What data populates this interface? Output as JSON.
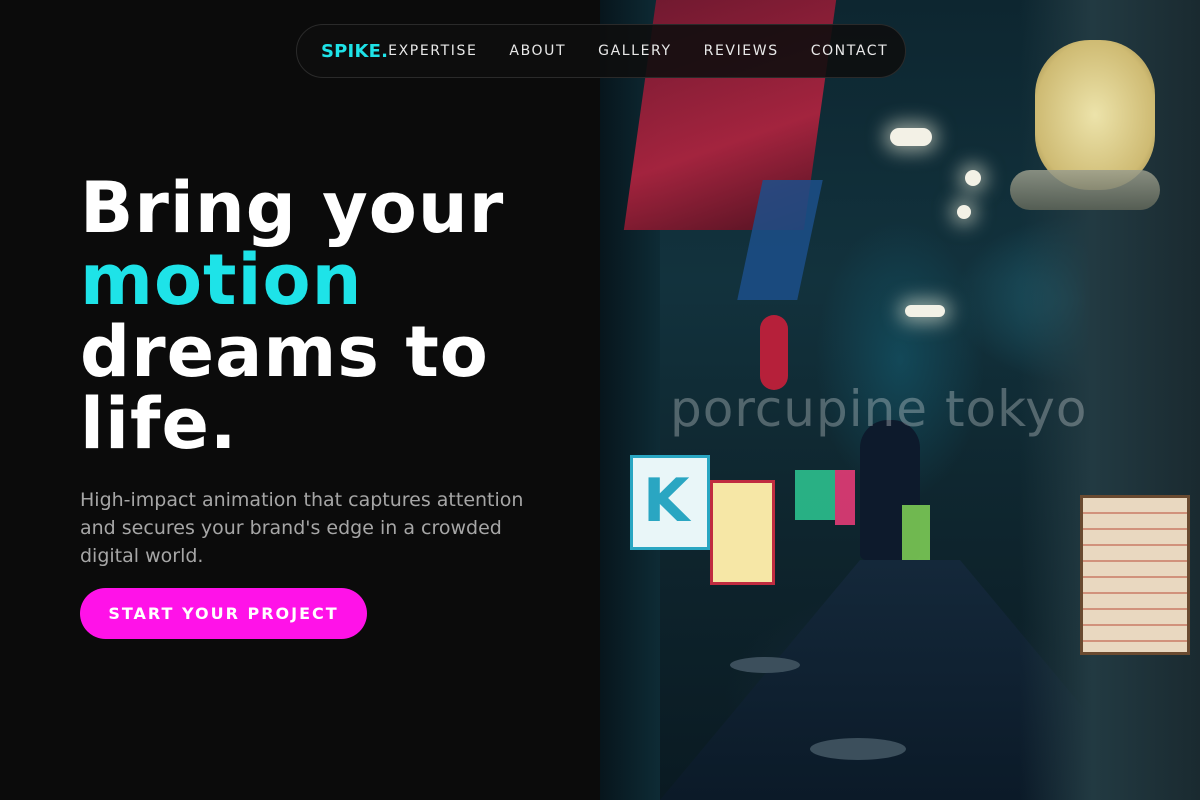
{
  "nav": {
    "logo": "SPIKE.",
    "links": [
      "EXPERTISE",
      "ABOUT",
      "GALLERY",
      "REVIEWS",
      "CONTACT"
    ]
  },
  "hero": {
    "title_line1": "Bring your",
    "title_accent": "motion",
    "title_line3": "dreams to",
    "title_line4": "life.",
    "subtitle": "High-impact animation that captures attention and secures your brand's edge in a crowded digital world.",
    "cta_label": "START YOUR PROJECT"
  },
  "photo": {
    "watermark": "porcupine tokyo"
  },
  "colors": {
    "accent": "#1ee3e8",
    "cta": "#ff12e8",
    "background": "#0b0b0b"
  }
}
